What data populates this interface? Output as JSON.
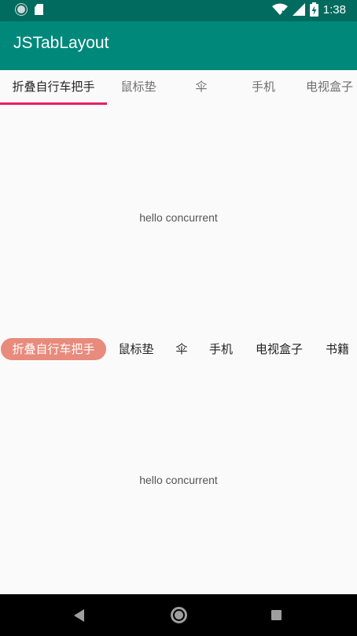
{
  "status_bar": {
    "time": "1:38"
  },
  "app_bar": {
    "title": "JSTabLayout"
  },
  "tabs_top": {
    "items": [
      "折叠自行车把手",
      "鼠标垫",
      "伞",
      "手机",
      "电视盒子"
    ],
    "selected": 0,
    "indicator_color": "#e91e63"
  },
  "content_top": {
    "text": "hello concurrent"
  },
  "tabs_pill": {
    "items": [
      "折叠自行车把手",
      "鼠标垫",
      "伞",
      "手机",
      "电视盒子",
      "书籍"
    ],
    "selected": 0,
    "pill_color": "#e88a7c"
  },
  "content_bottom": {
    "text": "hello concurrent"
  },
  "colors": {
    "status_bar": "#006b5e",
    "app_bar": "#00897b"
  },
  "icons": [
    "status-circle-icon",
    "sd-card-icon",
    "wifi-icon",
    "signal-icon",
    "battery-charging-icon",
    "back-icon",
    "home-icon",
    "recents-icon"
  ]
}
